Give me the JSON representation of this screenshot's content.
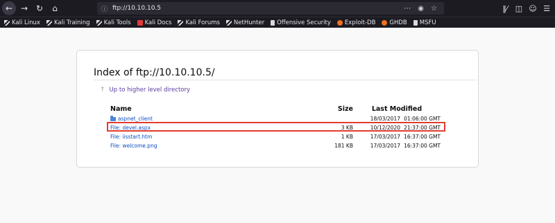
{
  "browser": {
    "url": "ftp://10.10.10.5",
    "nav_icons": [
      "back-icon",
      "forward-icon",
      "reload-icon",
      "home-icon"
    ],
    "right_icons": [
      "library-icon",
      "sidebar-icon",
      "account-icon",
      "menu-icon"
    ],
    "accent": "#1c1b22"
  },
  "bookmarks": [
    {
      "label": "Kali Linux",
      "icon": "kali-dragon-icon"
    },
    {
      "label": "Kali Training",
      "icon": "kali-dragon-icon"
    },
    {
      "label": "Kali Tools",
      "icon": "kali-dragon-icon"
    },
    {
      "label": "Kali Docs",
      "icon": "kali-docs-icon"
    },
    {
      "label": "Kali Forums",
      "icon": "kali-dragon-icon"
    },
    {
      "label": "NetHunter",
      "icon": "kali-dragon-icon"
    },
    {
      "label": "Offensive Security",
      "icon": "offsec-icon"
    },
    {
      "label": "Exploit-DB",
      "icon": "exploit-db-icon"
    },
    {
      "label": "GHDB",
      "icon": "exploit-db-icon"
    },
    {
      "label": "MSFU",
      "icon": "offsec-icon"
    }
  ],
  "page": {
    "title": "Index of ftp://10.10.10.5/",
    "up_link": "Up to higher level directory",
    "columns": {
      "name": "Name",
      "size": "Size",
      "modified": "Last Modified"
    },
    "files": [
      {
        "name": "aspnet_client",
        "size": "",
        "date": "18/03/2017",
        "time": "01:06:00 GMT",
        "is_folder": true
      },
      {
        "name": "File: devel.aspx",
        "size": "3 KB",
        "date": "10/12/2020",
        "time": "21:37:00 GMT",
        "highlighted": true
      },
      {
        "name": "File: iisstart.htm",
        "size": "1 KB",
        "date": "17/03/2017",
        "time": "16:37:00 GMT"
      },
      {
        "name": "File: welcome.png",
        "size": "181 KB",
        "date": "17/03/2017",
        "time": "16:37:00 GMT"
      }
    ],
    "highlight_color": "#e23b2e"
  }
}
